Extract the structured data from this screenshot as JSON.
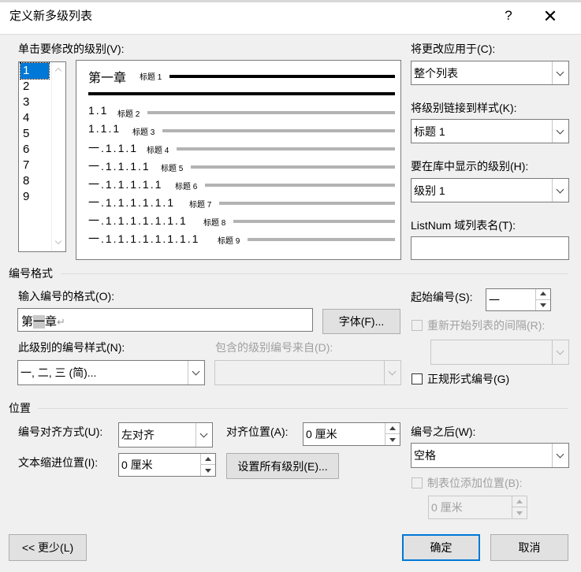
{
  "window": {
    "title": "定义新多级列表",
    "help": "?",
    "close": "✕"
  },
  "left": {
    "click_level_label": "单击要修改的级别(V):",
    "levels": [
      "1",
      "2",
      "3",
      "4",
      "5",
      "6",
      "7",
      "8",
      "9"
    ],
    "selected_level": "1"
  },
  "preview": {
    "rows": [
      {
        "num": "第一章",
        "style": "标题 1"
      },
      {
        "num": "1.1",
        "style": "标题 2"
      },
      {
        "num": "1.1.1",
        "style": "标题 3"
      },
      {
        "num": "一.1.1.1",
        "style": "标题 4"
      },
      {
        "num": "一.1.1.1.1",
        "style": "标题 5"
      },
      {
        "num": "一.1.1.1.1.1",
        "style": "标题 6"
      },
      {
        "num": "一.1.1.1.1.1.1",
        "style": "标题 7"
      },
      {
        "num": "一.1.1.1.1.1.1.1",
        "style": "标题 8"
      },
      {
        "num": "一.1.1.1.1.1.1.1.1",
        "style": "标题 9"
      }
    ]
  },
  "right": {
    "apply_to_label": "将更改应用于(C):",
    "apply_to_value": "整个列表",
    "link_style_label": "将级别链接到样式(K):",
    "link_style_value": "标题 1",
    "gallery_level_label": "要在库中显示的级别(H):",
    "gallery_level_value": "级别 1",
    "listnum_label": "ListNum 域列表名(T):",
    "listnum_value": ""
  },
  "number_format": {
    "section": "编号格式",
    "input_label": "输入编号的格式(O):",
    "input_value": {
      "prefix": "第",
      "highlight": "一",
      "suffix": "章",
      "mark": "↵"
    },
    "font_button": "字体(F)...",
    "style_label": "此级别的编号样式(N):",
    "style_value": "一, 二, 三 (简)...",
    "include_label": "包含的级别编号来自(D):",
    "include_value": "",
    "start_at_label": "起始编号(S):",
    "start_at_value": "一",
    "restart_label": "重新开始列表的间隔(R):",
    "restart_value": "",
    "legal_label": "正规形式编号(G)"
  },
  "position": {
    "section": "位置",
    "align_label": "编号对齐方式(U):",
    "align_value": "左对齐",
    "align_at_label": "对齐位置(A):",
    "align_at_value": "0 厘米",
    "indent_label": "文本缩进位置(I):",
    "indent_value": "0 厘米",
    "set_all_button": "设置所有级别(E)...",
    "follow_label": "编号之后(W):",
    "follow_value": "空格",
    "tab_add_label": "制表位添加位置(B):",
    "tab_add_value": "0 厘米"
  },
  "footer": {
    "less_button": "<< 更少(L)",
    "ok_button": "确定",
    "cancel_button": "取消"
  },
  "colors": {
    "accent": "#0078d7",
    "dialog_bg": "#f0f0f0",
    "disabled_text": "#a0a0a0"
  }
}
